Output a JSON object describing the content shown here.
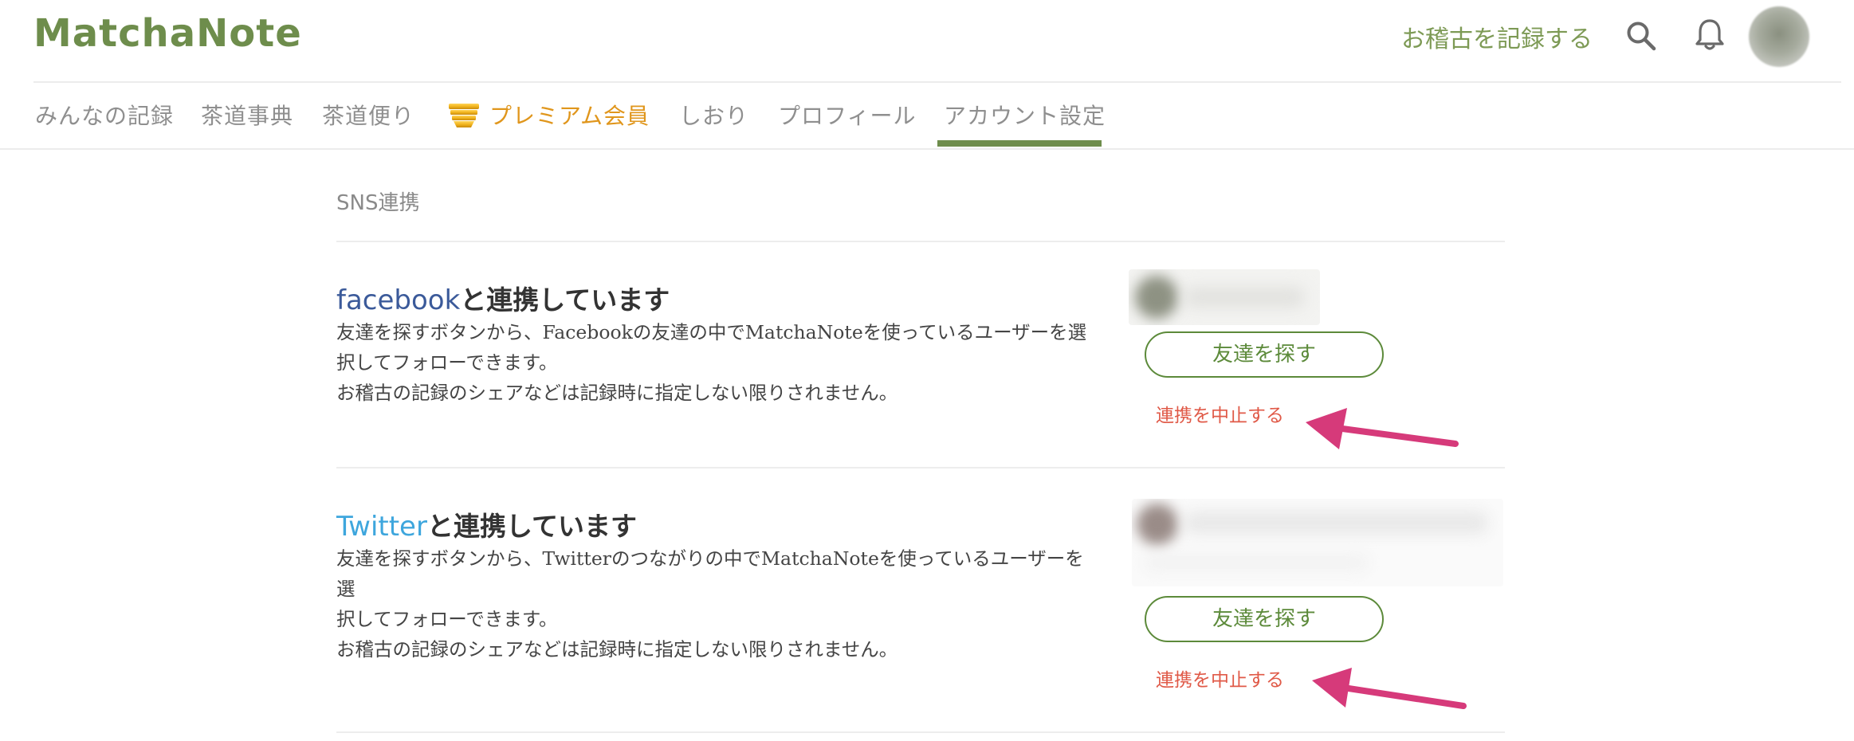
{
  "header": {
    "logo": "MatchaNote",
    "record_link": "お稽古を記録する",
    "icons": {
      "search": "search-icon",
      "notifications": "bell-icon",
      "avatar": "avatar"
    }
  },
  "tabs": [
    {
      "label": "みんなの記録",
      "active": false
    },
    {
      "label": "茶道事典",
      "active": false
    },
    {
      "label": "茶道便り",
      "active": false
    },
    {
      "label": "プレミアム会員",
      "active": false,
      "icon": "crown-icon"
    },
    {
      "label": "しおり",
      "active": false
    },
    {
      "label": "プロフィール",
      "active": false
    },
    {
      "label": "アカウント設定",
      "active": true
    }
  ],
  "section_title": "SNS連携",
  "services": [
    {
      "brand": "facebook",
      "heading_suffix": "と連携しています",
      "description": [
        "友達を探すボタンから、Facebookの友達の中でMatchaNoteを使っているユーザーを選",
        "択してフォローできます。",
        "お稽古の記録のシェアなどは記録時に指定しない限りされません。"
      ],
      "find_button": "友達を探す",
      "stop_link": "連携を中止する"
    },
    {
      "brand": "Twitter",
      "heading_suffix": "と連携しています",
      "description": [
        "友達を探すボタンから、Twitterのつながりの中でMatchaNoteを使っているユーザーを選",
        "択してフォローできます。",
        "お稽古の記録のシェアなどは記録時に指定しない限りされません。"
      ],
      "find_button": "友達を探す",
      "stop_link": "連携を中止する"
    }
  ],
  "colors": {
    "brand_green": "#6e8d4c",
    "premium_gold": "#e0961c",
    "facebook_blue": "#3b5a9a",
    "twitter_blue": "#3ea6dd",
    "stop_red": "#e05a48",
    "annotation_arrow": "#d63a7a"
  }
}
